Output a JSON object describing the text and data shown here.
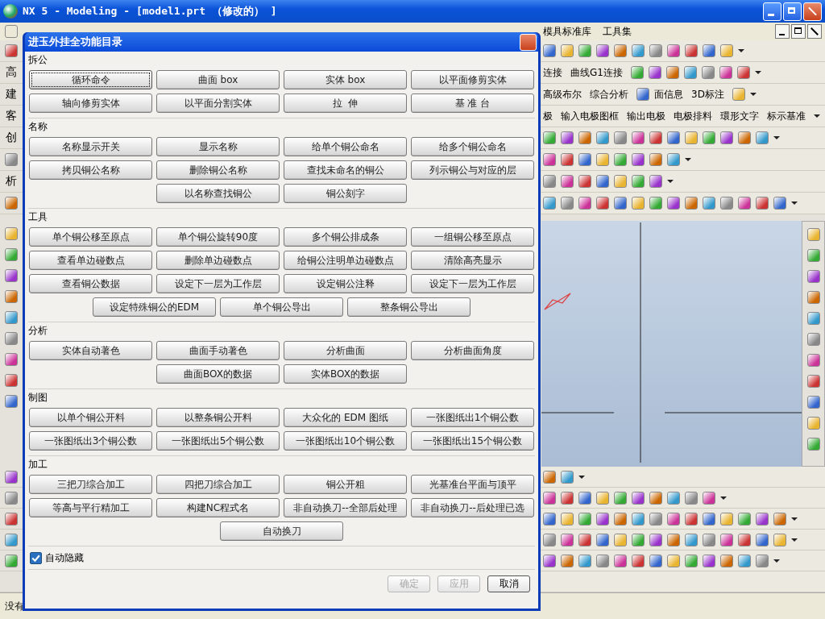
{
  "window": {
    "title": "NX 5 - Modeling - [model1.prt （修改的） ]"
  },
  "menu_bar": {
    "items": [
      "模具标准库",
      "工具集"
    ]
  },
  "toolbar_rows": [
    {
      "items": []
    },
    {
      "left_label": "高",
      "items": [
        "连接",
        "曲线G1连接"
      ]
    },
    {
      "left_label": "建",
      "items": [
        "高级布尔",
        "综合分析",
        "面信息",
        "3D标注"
      ]
    },
    {
      "left_label": "客",
      "items": [
        "极",
        "输入电极图框",
        "输出电极",
        "电极排料",
        "環形文字",
        "标示基准"
      ]
    },
    {
      "left_label": "创",
      "items": []
    },
    {
      "items": []
    },
    {
      "left_label": "析",
      "items": []
    },
    {
      "items": []
    }
  ],
  "status_bar": {
    "text": "没有"
  },
  "dialog": {
    "title": "进玉外挂全功能目录",
    "sections": [
      {
        "title": "拆公",
        "rows": [
          [
            {
              "label": "循环命令",
              "focused": true
            },
            {
              "label": "曲面 box",
              "focused": false
            },
            {
              "label": "实体 box",
              "focused": false
            },
            {
              "label": "以平面修剪实体",
              "focused": false
            }
          ],
          [
            {
              "label": "轴向修剪实体",
              "focused": false
            },
            {
              "label": "以平面分割实体",
              "focused": false
            },
            {
              "label": "拉  伸",
              "focused": false
            },
            {
              "label": "基 准 台",
              "focused": false
            }
          ]
        ]
      },
      {
        "title": "名称",
        "rows": [
          [
            {
              "label": "名称显示开关",
              "focused": false
            },
            {
              "label": "显示名称",
              "focused": false
            },
            {
              "label": "给单个铜公命名",
              "focused": false
            },
            {
              "label": "给多个铜公命名",
              "focused": false
            }
          ],
          [
            {
              "label": "拷贝铜公名称",
              "focused": false
            },
            {
              "label": "删除铜公名称",
              "focused": false
            },
            {
              "label": "查找未命名的铜公",
              "focused": false
            },
            {
              "label": "列示铜公与对应的层",
              "focused": false
            }
          ],
          [
            "",
            {
              "label": "以名称查找铜公",
              "focused": false
            },
            {
              "label": "铜公刻字",
              "focused": false
            },
            ""
          ]
        ]
      },
      {
        "title": "工具",
        "rows": [
          [
            {
              "label": "单个铜公移至原点",
              "focused": false
            },
            {
              "label": "单个铜公旋转90度",
              "focused": false
            },
            {
              "label": "多个铜公排成条",
              "focused": false
            },
            {
              "label": "一组铜公移至原点",
              "focused": false
            }
          ],
          [
            {
              "label": "查看单边碰数点",
              "focused": false
            },
            {
              "label": "删除单边碰数点",
              "focused": false
            },
            {
              "label": "给铜公注明单边碰数点",
              "focused": false
            },
            {
              "label": "清除高亮显示",
              "focused": false
            }
          ],
          [
            {
              "label": "查看铜公数据",
              "focused": false
            },
            {
              "label": "设定下一层为工作层",
              "focused": false
            },
            {
              "label": "设定铜公注释",
              "focused": false
            },
            {
              "label": "设定下一层为工作层",
              "focused": false
            }
          ],
          [
            {
              "label": "设定特殊铜公的EDM",
              "focused": false
            },
            {
              "label": "单个铜公导出",
              "focused": false
            },
            {
              "label": "整条铜公导出",
              "focused": false
            }
          ]
        ]
      },
      {
        "title": "分析",
        "rows": [
          [
            {
              "label": "实体自动著色",
              "focused": false
            },
            {
              "label": "曲面手动著色",
              "focused": false
            },
            {
              "label": "分析曲面",
              "focused": false
            },
            {
              "label": "分析曲面角度",
              "focused": false
            }
          ],
          [
            "",
            {
              "label": "曲面BOX的数据",
              "focused": false
            },
            {
              "label": "实体BOX的数据",
              "focused": false
            },
            ""
          ]
        ]
      },
      {
        "title": "制图",
        "rows": [
          [
            {
              "label": "以单个铜公开料",
              "focused": false
            },
            {
              "label": "以整条铜公开料",
              "focused": false
            },
            {
              "label": "大众化的 EDM 图纸",
              "focused": false
            },
            {
              "label": "一张图纸出1个铜公数",
              "focused": false
            }
          ],
          [
            {
              "label": "一张图纸出3个铜公数",
              "focused": false
            },
            {
              "label": "一张图纸出5个铜公数",
              "focused": false
            },
            {
              "label": "一张图纸出10个铜公数",
              "focused": false
            },
            {
              "label": "一张图纸出15个铜公数",
              "focused": false
            }
          ]
        ]
      },
      {
        "title": "加工",
        "rows": [
          [
            {
              "label": "三把刀综合加工",
              "focused": false
            },
            {
              "label": "四把刀综合加工",
              "focused": false
            },
            {
              "label": "铜公开粗",
              "focused": false
            },
            {
              "label": "光基准台平面与顶平",
              "focused": false
            }
          ],
          [
            {
              "label": "等高与平行精加工",
              "focused": false
            },
            {
              "label": "构建NC程式名",
              "focused": false
            },
            {
              "label": "非自动换刀--全部后处理",
              "focused": false
            },
            {
              "label": "非自动换刀--后处理已选",
              "focused": false
            }
          ],
          [
            {
              "label": "自动换刀",
              "focused": false
            }
          ]
        ]
      }
    ],
    "checkbox": {
      "label": "自动隐藏",
      "checked": true
    },
    "buttons": [
      {
        "label": "确定",
        "disabled": true
      },
      {
        "label": "应用",
        "disabled": true
      },
      {
        "label": "取消",
        "disabled": false
      }
    ]
  }
}
